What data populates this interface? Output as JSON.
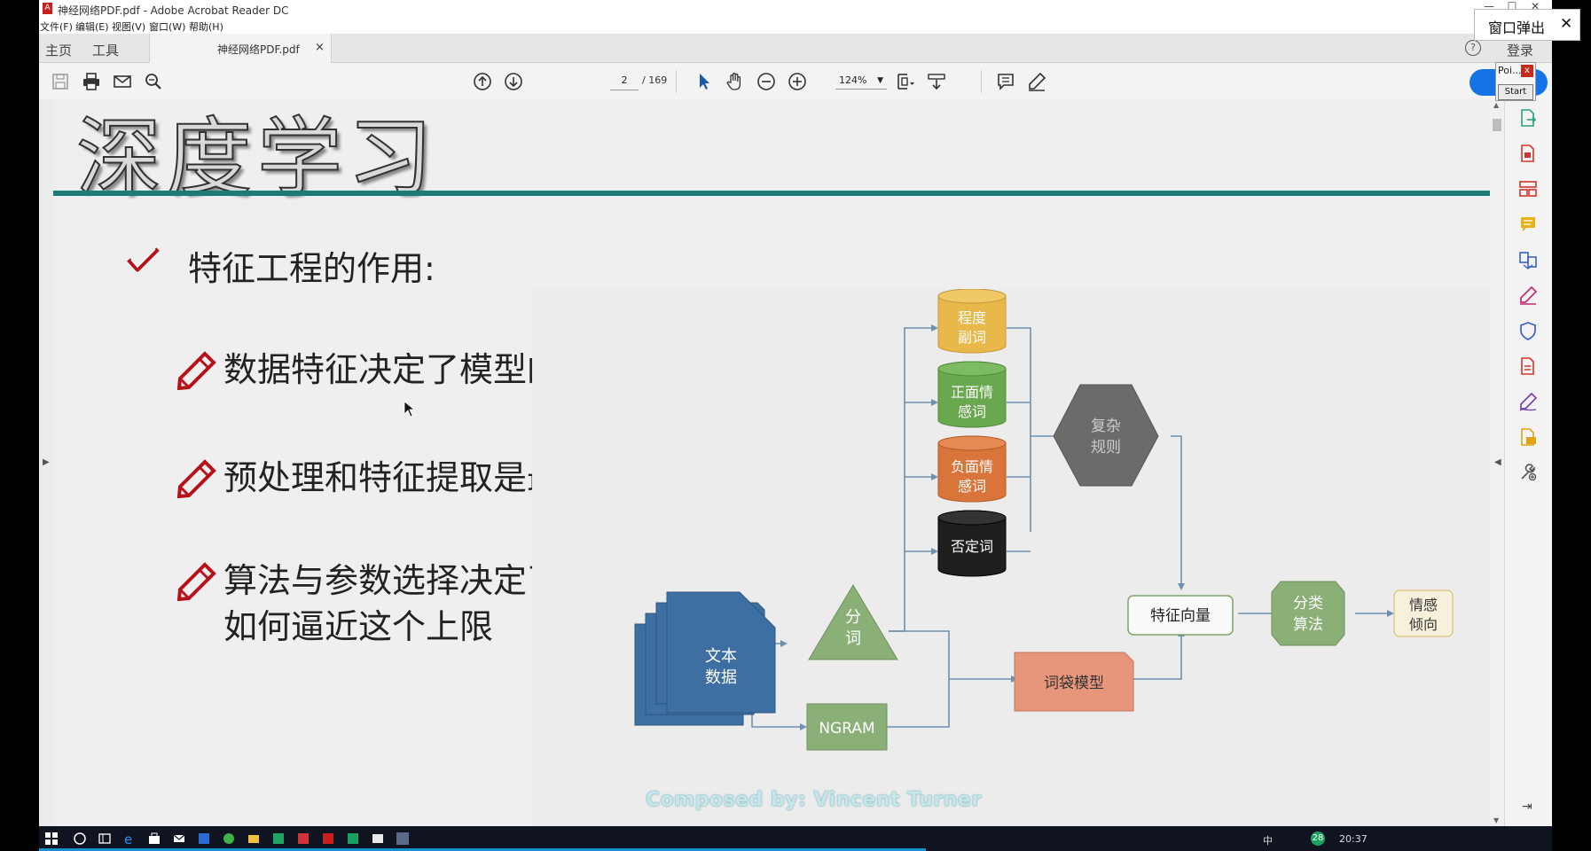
{
  "window": {
    "title": "神经网络PDF.pdf - Adobe Acrobat Reader DC",
    "controls": [
      "—",
      "☐",
      "✕"
    ]
  },
  "menu": [
    "文件(F)",
    "编辑(E)",
    "视图(V)",
    "窗口(W)",
    "帮助(H)"
  ],
  "tabs": {
    "home": "主页",
    "tools": "工具",
    "document": "神经网络PDF.pdf",
    "close": "×",
    "login": "登录",
    "help": "?"
  },
  "toolbar": {
    "page_current": "2",
    "page_total": "/ 169",
    "zoom": "124%"
  },
  "float_window": {
    "label": "窗口弹出",
    "close": "✕"
  },
  "popup": {
    "label": "Poi...",
    "close": "x",
    "start": "Start"
  },
  "slide": {
    "title": "深度学习",
    "heading": "特征工程的作用:",
    "bullets": [
      "数据特征决定了模型的上限",
      "预处理和特征提取是最核心的",
      "算法与参数选择决定了",
      "如何逼近这个上限"
    ],
    "footer": "Composed by:  Vincent Turner"
  },
  "diagram": {
    "text_data": [
      "文本",
      "数据"
    ],
    "segment": [
      "分",
      "词"
    ],
    "ngram": "NGRAM",
    "degree_adverb": [
      "程度",
      "副词"
    ],
    "positive": [
      "正面情",
      "感词"
    ],
    "negative": [
      "负面情",
      "感词"
    ],
    "negation": "否定词",
    "complex_rules": [
      "复杂",
      "规则"
    ],
    "bag_of_words": "词袋模型",
    "feature_vector": "特征向量",
    "classifier": [
      "分类",
      "算法"
    ],
    "sentiment": [
      "情感",
      "倾向"
    ],
    "colors": {
      "blue": "#3e6fa3",
      "green": "#8bb077",
      "yellow": "#e8b84a",
      "orange": "#d9743a",
      "black": "#1f1f1f",
      "gray": "#6b6b6b",
      "salmon": "#e8967b"
    }
  },
  "taskbar": {
    "time": "20:37",
    "ime": "中",
    "badge": "28"
  }
}
